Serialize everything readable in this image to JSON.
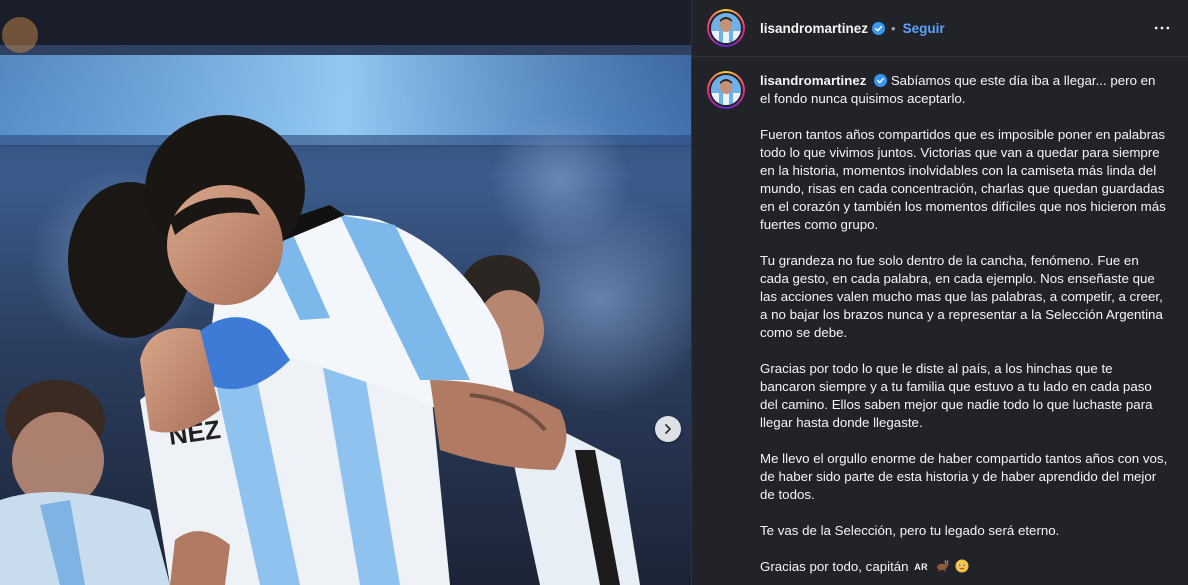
{
  "post": {
    "username": "lisandromartinez",
    "separator": "•",
    "follow_label": "Seguir",
    "icons": {
      "verified": "verified-badge-icon",
      "more": "more-options-icon",
      "next": "chevron-right-icon",
      "emoji_goat": "goat-emoji-icon",
      "emoji_face": "holding-back-tears-emoji-icon"
    },
    "accent_color": "#5aa2ff",
    "caption": {
      "author": "lisandromartinez",
      "first": "Sabíamos que este día iba a llegar... pero en el fondo nunca quisimos aceptarlo.",
      "p2": "Fueron tantos años compartidos que es imposible poner en palabras todo lo que vivimos juntos. Victorias que van a quedar para siempre en la historia, momentos inolvidables con la camiseta más linda del mundo, risas en cada concentración, charlas que quedan guardadas en el corazón y también los momentos difíciles que nos hicieron más fuertes como grupo.",
      "p3": "Tu grandeza no fue solo dentro de la cancha, fenómeno. Fue en cada gesto, en cada palabra, en cada ejemplo. Nos enseñaste que las acciones valen mucho mas que las palabras, a competir, a creer, a no bajar los brazos nunca y a representar a la Selección Argentina como se debe.",
      "p4": "Gracias por todo lo que le diste al país, a los hinchas que te bancaron siempre y a tu familia que estuvo a tu lado en cada paso del camino. Ellos saben mejor que nadie todo lo que luchaste para llegar hasta donde llegaste.",
      "p5": "Me llevo el orgullo enorme de haber compartido tantos años con vos, de haber sido parte de esta historia y de haber aprendido del mejor de todos.",
      "p6": "Te vas de la Selección, pero tu legado será eterno.",
      "p7": "Gracias por todo, capitán",
      "flag": "AR"
    }
  }
}
